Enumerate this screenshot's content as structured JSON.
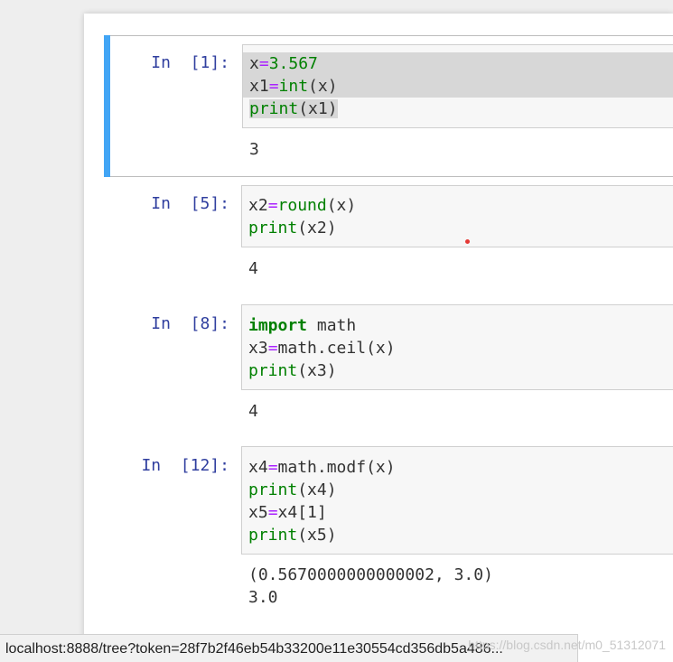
{
  "cells": [
    {
      "prompt": "In  [1]:",
      "lines": [
        [
          {
            "t": "x",
            "c": ""
          },
          {
            "t": "=",
            "c": "op"
          },
          {
            "t": "3.567",
            "c": "num"
          }
        ],
        [
          {
            "t": "x1",
            "c": ""
          },
          {
            "t": "=",
            "c": "op"
          },
          {
            "t": "int",
            "c": "builtin"
          },
          {
            "t": "(x)",
            "c": ""
          }
        ],
        [
          {
            "t": "print",
            "c": "builtin"
          },
          {
            "t": "(x1)",
            "c": ""
          }
        ]
      ],
      "output": "3"
    },
    {
      "prompt": "In  [5]:",
      "lines": [
        [
          {
            "t": "x2",
            "c": ""
          },
          {
            "t": "=",
            "c": "op"
          },
          {
            "t": "round",
            "c": "builtin"
          },
          {
            "t": "(x)",
            "c": ""
          }
        ],
        [
          {
            "t": "print",
            "c": "builtin"
          },
          {
            "t": "(x2)",
            "c": ""
          }
        ]
      ],
      "output": "4"
    },
    {
      "prompt": "In  [8]:",
      "lines": [
        [
          {
            "t": "import",
            "c": "kw"
          },
          {
            "t": " math",
            "c": ""
          }
        ],
        [
          {
            "t": "x3",
            "c": ""
          },
          {
            "t": "=",
            "c": "op"
          },
          {
            "t": "math.ceil(x)",
            "c": ""
          }
        ],
        [
          {
            "t": "print",
            "c": "builtin"
          },
          {
            "t": "(x3)",
            "c": ""
          }
        ]
      ],
      "output": "4"
    },
    {
      "prompt": "In  [12]:",
      "lines": [
        [
          {
            "t": "x4",
            "c": ""
          },
          {
            "t": "=",
            "c": "op"
          },
          {
            "t": "math.modf(x)",
            "c": ""
          }
        ],
        [
          {
            "t": "print",
            "c": "builtin"
          },
          {
            "t": "(x4)",
            "c": ""
          }
        ],
        [
          {
            "t": "x5",
            "c": ""
          },
          {
            "t": "=",
            "c": "op"
          },
          {
            "t": "x4[1]",
            "c": ""
          }
        ],
        [
          {
            "t": "print",
            "c": "builtin"
          },
          {
            "t": "(x5)",
            "c": ""
          }
        ]
      ],
      "output": "(0.5670000000000002, 3.0)\n3.0"
    }
  ],
  "status_url": "localhost:8888/tree?token=28f7b2f46eb54b33200e11e30554cd356db5a486...",
  "watermark": "https://blog.csdn.net/m0_51312071",
  "colors": {
    "accent": "#42a5f5",
    "prompt": "#303f9f",
    "keyword": "#008000",
    "operator": "#aa22ff"
  }
}
